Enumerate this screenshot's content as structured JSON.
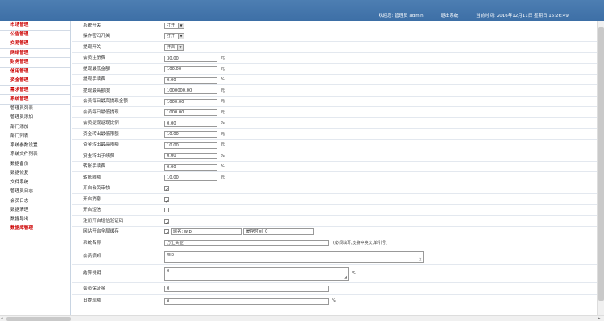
{
  "header": {
    "user_label": "欢迎您: 管理员 admin",
    "logout_label": "退出系统",
    "time_label": "当前时间: 2016年12月11日 星期日 15:26:49"
  },
  "sidebar": {
    "items": [
      {
        "label": "市场管理",
        "kind": "head"
      },
      {
        "label": "公告管理",
        "kind": "head"
      },
      {
        "label": "交易管理",
        "kind": "head"
      },
      {
        "label": "网络管理",
        "kind": "head"
      },
      {
        "label": "财务管理",
        "kind": "head"
      },
      {
        "label": "信用管理",
        "kind": "head"
      },
      {
        "label": "资金管理",
        "kind": "head"
      },
      {
        "label": "需求管理",
        "kind": "head"
      },
      {
        "label": "系统管理",
        "kind": "head"
      },
      {
        "label": "管理员列表",
        "kind": "sub"
      },
      {
        "label": "管理员添加",
        "kind": "sub"
      },
      {
        "label": "部门添加",
        "kind": "sub"
      },
      {
        "label": "部门列表",
        "kind": "sub"
      },
      {
        "label": "系统参数设置",
        "kind": "sub"
      },
      {
        "label": "系统文件列表",
        "kind": "sub"
      },
      {
        "label": "数据备份",
        "kind": "sub"
      },
      {
        "label": "数据恢复",
        "kind": "sub"
      },
      {
        "label": "文件系统",
        "kind": "sub"
      },
      {
        "label": "管理员日志",
        "kind": "sub"
      },
      {
        "label": "会员日志",
        "kind": "sub"
      },
      {
        "label": "数据清理",
        "kind": "sub"
      },
      {
        "label": "数据导出",
        "kind": "sub"
      },
      {
        "label": "数据库管理",
        "kind": "tail"
      }
    ]
  },
  "form": {
    "fields": [
      {
        "label": "系统开关",
        "type": "select",
        "value": "打开"
      },
      {
        "label": "操作密码开关",
        "type": "select",
        "value": "打开"
      },
      {
        "label": "提现开关",
        "type": "select",
        "value": "开启"
      },
      {
        "label": "会员注册费",
        "type": "input",
        "value": "30.00",
        "unit": "元"
      },
      {
        "label": "提现最低金额",
        "type": "input",
        "value": "100.00",
        "unit": "元"
      },
      {
        "label": "提现手续费",
        "type": "input",
        "value": "0.00",
        "unit": "%"
      },
      {
        "label": "提现最高额度",
        "type": "input",
        "value": "1000000.00",
        "unit": "元"
      },
      {
        "label": "会员每日最高提现金额",
        "type": "input",
        "value": "1000.00",
        "unit": "元"
      },
      {
        "label": "会员每日最低提现",
        "type": "input",
        "value": "1000.00",
        "unit": "元"
      },
      {
        "label": "会员提现返现比例",
        "type": "input",
        "value": "0.00",
        "unit": "%"
      },
      {
        "label": "资金转出最低限额",
        "type": "input",
        "value": "10.00",
        "unit": "元"
      },
      {
        "label": "资金转出最高限额",
        "type": "input",
        "value": "10.00",
        "unit": "元"
      },
      {
        "label": "资金转出手续费",
        "type": "input",
        "value": "0.00",
        "unit": "%"
      },
      {
        "label": "转账手续费",
        "type": "input",
        "value": "0.00",
        "unit": "%"
      },
      {
        "label": "转账限额",
        "type": "input",
        "value": "10.00",
        "unit": "元"
      },
      {
        "label": "开启会员审核",
        "type": "check",
        "checked": true
      },
      {
        "label": "开启消息",
        "type": "check",
        "checked": true
      },
      {
        "label": "开启短信",
        "type": "check",
        "checked": false
      },
      {
        "label": "注册开启短信验证码",
        "type": "check",
        "checked": true
      },
      {
        "label": "网站开启全局缓存",
        "type": "cache",
        "checked": true,
        "text1": "域名: wip",
        "text2": "缓存时间: 0"
      },
      {
        "label": "系统名称",
        "type": "name",
        "value": "万汇实业",
        "note": "(必须填写,支持中英文,单引号)"
      },
      {
        "label": "会员须知",
        "type": "textarea",
        "value": "wip"
      },
      {
        "label": "结算说明",
        "type": "textarea2",
        "value": "0",
        "unit": "%"
      },
      {
        "label": "会员保证金",
        "type": "wide",
        "value": "0"
      },
      {
        "label": "日提现额",
        "type": "wide",
        "value": "0",
        "unit": "%"
      }
    ]
  }
}
